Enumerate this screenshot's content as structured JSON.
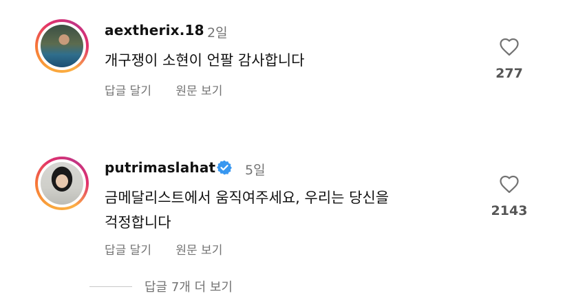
{
  "comments": [
    {
      "username": "aextherix.18",
      "time": "2일",
      "text": "개구쟁이 소현이 언팔 감사합니다",
      "reply_label": "답글 달기",
      "translate_label": "원문 보기",
      "likes": "277",
      "verified": false
    },
    {
      "username": "putrimaslahat",
      "time": "5일",
      "text_line1": "금메달리스트에서 움직여주세요, 우리는 당신을",
      "text_line2": "걱정합니다",
      "reply_label": "답글 달기",
      "translate_label": "원문 보기",
      "likes": "2143",
      "verified": true
    }
  ],
  "view_more_replies": "답글 7개 더 보기",
  "colors": {
    "verified_badge": "#3897f0",
    "secondary_text": "#737373",
    "divider": "#c7c7c7"
  },
  "icons": [
    "heart-icon",
    "verified-badge-icon"
  ]
}
